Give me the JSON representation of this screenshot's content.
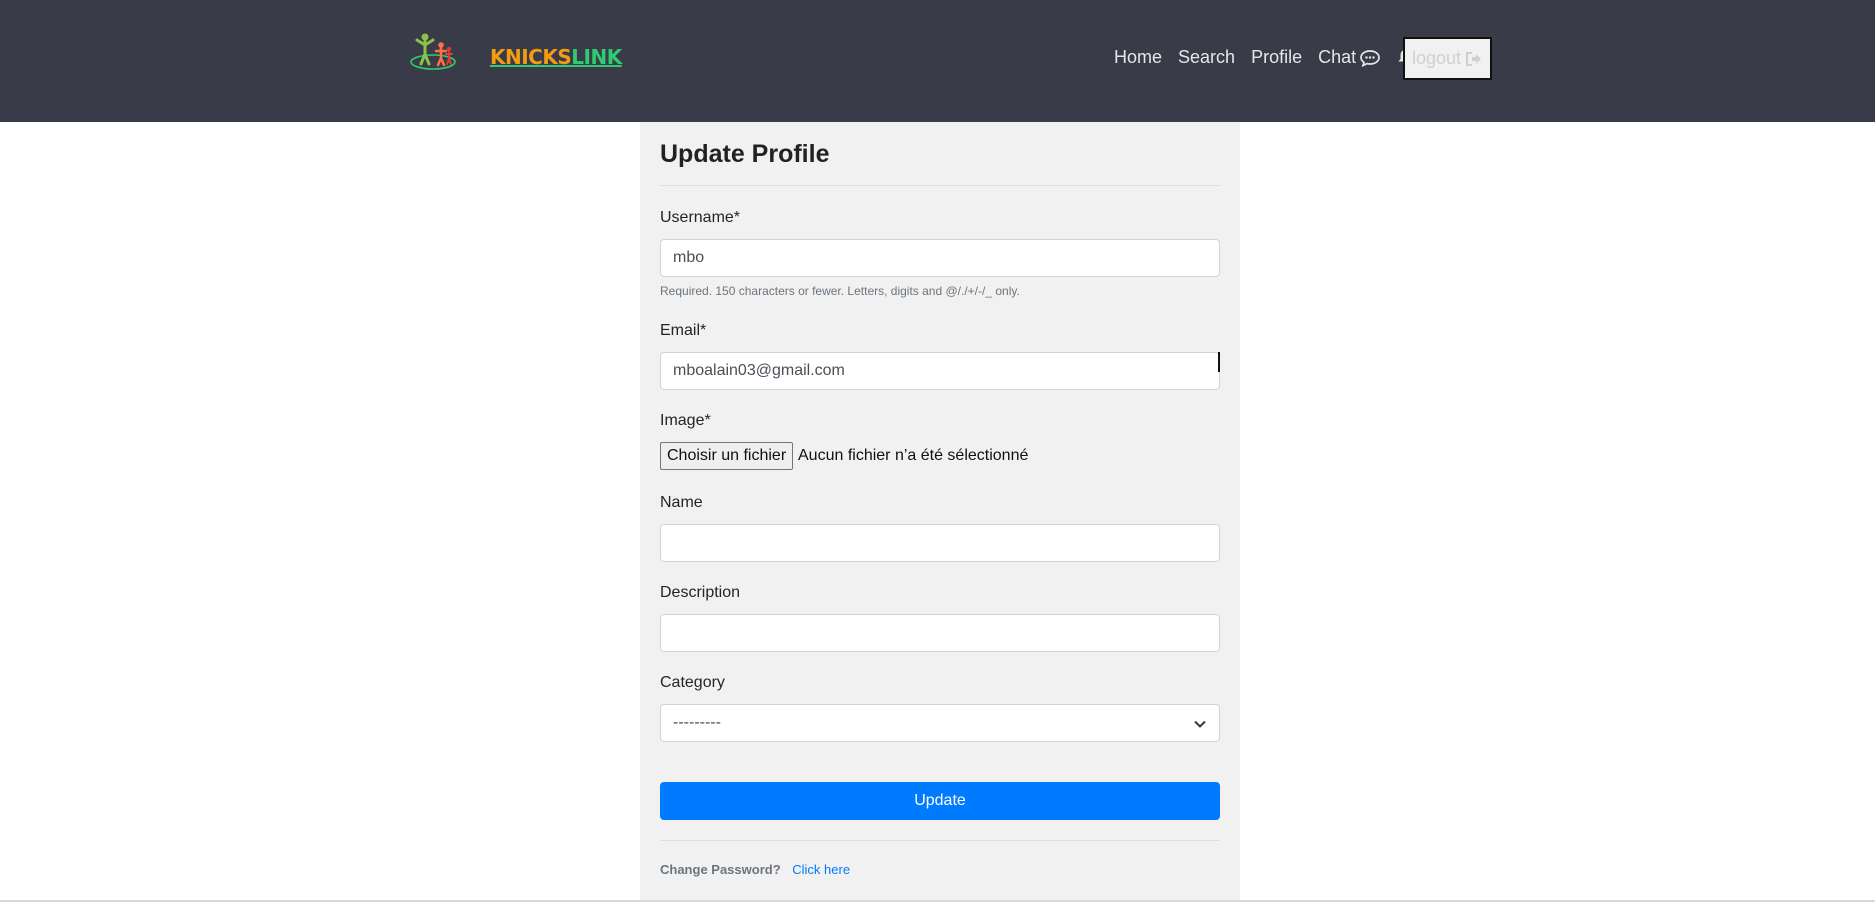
{
  "brand": {
    "part1": "KNICKS",
    "part2": "LINK"
  },
  "nav": {
    "home": "Home",
    "search": "Search",
    "profile": "Profile",
    "chat": "Chat",
    "logout": "logout"
  },
  "form": {
    "title": "Update Profile",
    "username_label": "Username*",
    "username_value": "mbo",
    "username_help": "Required. 150 characters or fewer. Letters, digits and @/./+/-/_ only.",
    "email_label": "Email*",
    "email_value": "mboalain03@gmail.com",
    "image_label": "Image*",
    "file_button": "Choisir un fichier",
    "file_status": "Aucun fichier n’a été sélectionné",
    "name_label": "Name",
    "name_value": "",
    "description_label": "Description",
    "description_value": "",
    "category_label": "Category",
    "category_selected": "---------",
    "submit": "Update"
  },
  "footer": {
    "prompt": "Change Password?",
    "link": "Click here"
  },
  "colors": {
    "navbar": "#3a3b49",
    "brand_orange": "#f39c12",
    "brand_green": "#2ecc71",
    "primary": "#007bff",
    "card": "#f1f1f1"
  },
  "icons": [
    "logo-icon",
    "chat-icon",
    "bell-icon",
    "logout-icon",
    "chevron-down-icon"
  ]
}
